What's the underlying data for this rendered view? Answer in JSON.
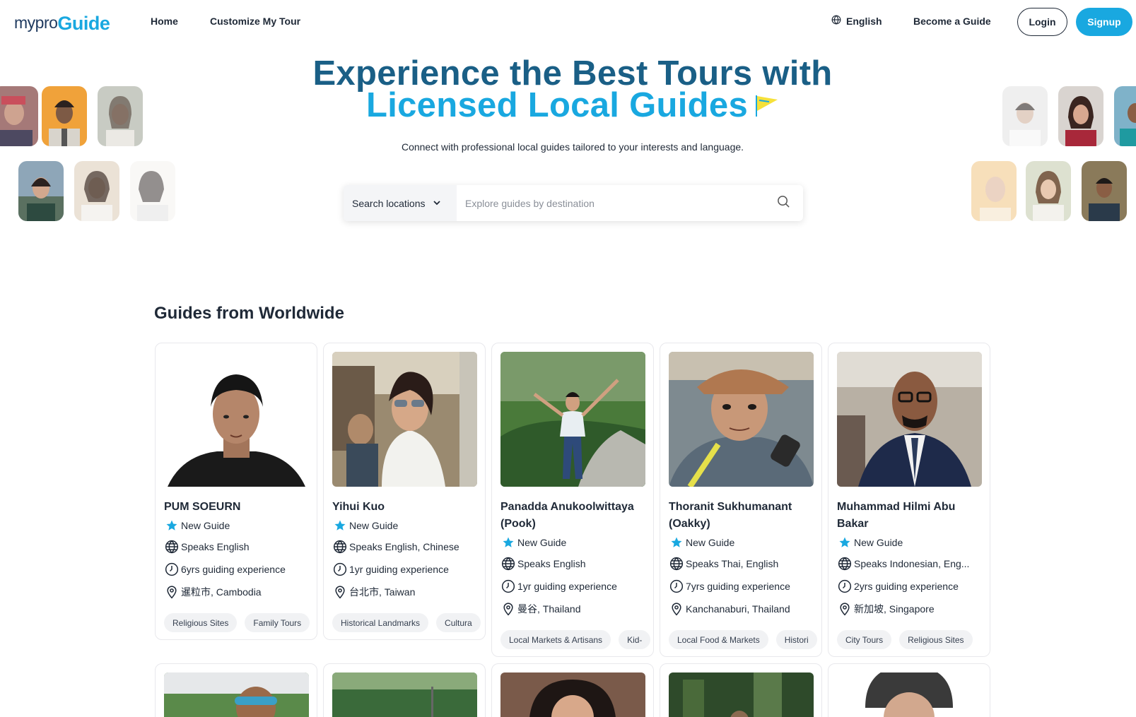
{
  "nav": {
    "logo_part1": "mypro",
    "logo_part2": "Guide",
    "home": "Home",
    "customize": "Customize My Tour",
    "language": "English",
    "become_guide": "Become a Guide",
    "login": "Login",
    "signup": "Signup"
  },
  "hero": {
    "title_line1": "Experience the Best Tours with",
    "title_line2": "Licensed Local Guides",
    "subtitle": "Connect with professional local guides tailored to your interests and language.",
    "search_select": "Search locations",
    "search_placeholder": "Explore guides by destination"
  },
  "section": {
    "title": "Guides from Worldwide"
  },
  "guides": [
    {
      "name": "PUM SOEURN",
      "status": "New Guide",
      "languages": "Speaks English",
      "experience": "6yrs guiding experience",
      "location": "暹粒市, Cambodia",
      "tags": [
        "Religious Sites",
        "Family Tours"
      ]
    },
    {
      "name": "Yihui Kuo",
      "status": "New Guide",
      "languages": "Speaks English, Chinese",
      "experience": "1yr guiding experience",
      "location": "台北市, Taiwan",
      "tags": [
        "Historical Landmarks",
        "Cultura"
      ]
    },
    {
      "name": "Panadda Anukoolwittaya (Pook)",
      "status": "New Guide",
      "languages": "Speaks English",
      "experience": "1yr guiding experience",
      "location": "曼谷, Thailand",
      "tags": [
        "Local Markets & Artisans",
        "Kid-"
      ]
    },
    {
      "name": "Thoranit Sukhumanant (Oakky)",
      "status": "New Guide",
      "languages": "Speaks Thai, English",
      "experience": "7yrs guiding experience",
      "location": "Kanchanaburi, Thailand",
      "tags": [
        "Local Food & Markets",
        "Histori"
      ]
    },
    {
      "name": "Muhammad Hilmi Abu Bakar",
      "status": "New Guide",
      "languages": "Speaks Indonesian, Eng...",
      "experience": "2yrs guiding experience",
      "location": "新加坡, Singapore",
      "tags": [
        "City Tours",
        "Religious Sites"
      ]
    }
  ],
  "colors": {
    "brand_blue": "#19a8e0",
    "brand_dark": "#1a5f86",
    "star": "#19a8e0"
  },
  "icons": {
    "language": "globe-icon",
    "select": "chevron-down-icon",
    "search": "magnifier-icon",
    "status": "star-icon",
    "languages": "globe-icon",
    "experience": "clock-icon",
    "location": "map-pin-icon",
    "hero_flag": "flag-icon"
  }
}
